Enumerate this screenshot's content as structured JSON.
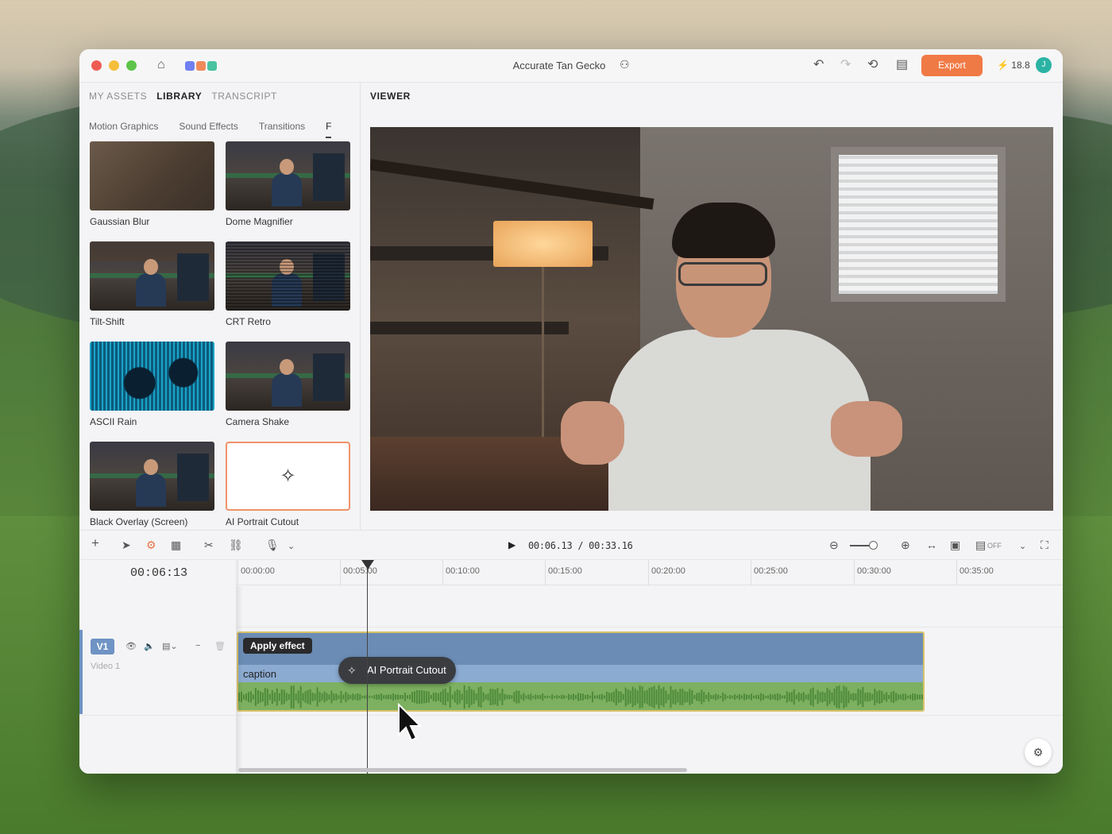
{
  "window": {
    "project_name": "Accurate Tan Gecko",
    "export_label": "Export",
    "credits": "18.8",
    "avatar_initial": "J",
    "accent_color": "#f07a45"
  },
  "left_panel": {
    "tabs": [
      {
        "label": "MY ASSETS",
        "active": false
      },
      {
        "label": "LIBRARY",
        "active": true
      },
      {
        "label": "TRANSCRIPT",
        "active": false
      }
    ],
    "subtabs": [
      "Motion Graphics",
      "Sound Effects",
      "Transitions",
      "F"
    ],
    "effects": [
      {
        "label": "Gaussian Blur",
        "thumb": "blur"
      },
      {
        "label": "Dome Magnifier",
        "thumb": "room"
      },
      {
        "label": "Tilt-Shift",
        "thumb": "room-tilt"
      },
      {
        "label": "CRT Retro",
        "thumb": "room-crt"
      },
      {
        "label": "ASCII Rain",
        "thumb": "ascii"
      },
      {
        "label": "Camera Shake",
        "thumb": "room"
      },
      {
        "label": "Black Overlay (Screen)",
        "thumb": "room"
      },
      {
        "label": "AI Portrait Cutout",
        "thumb": "sparkle-icon",
        "selected": true
      }
    ]
  },
  "viewer": {
    "title": "VIEWER"
  },
  "toolbar": {
    "timecode": "00:06.13 / 00:33.16",
    "snap_label": "OFF"
  },
  "timeline": {
    "current_time": "00:06:13",
    "ticks": [
      "00:00:00",
      "00:05:00",
      "00:10:00",
      "00:15:00",
      "00:20:00",
      "00:25:00",
      "00:30:00",
      "00:35:00"
    ],
    "track": {
      "badge": "V1",
      "name": "Video 1"
    },
    "clip": {
      "apply_effect_label": "Apply effect",
      "caption_label": "caption"
    },
    "drag_pill_label": "AI Portrait Cutout"
  }
}
